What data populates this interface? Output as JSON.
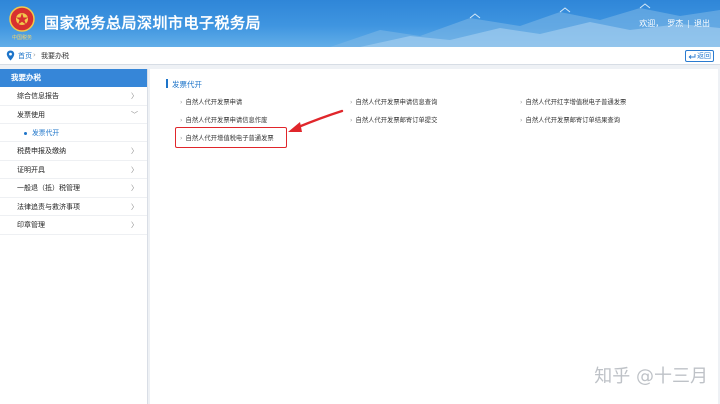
{
  "header": {
    "title": "国家税务总局深圳市电子税务局",
    "welcome": "欢迎，",
    "user": "罗杰",
    "logout": "退出",
    "emblem_text": "中国税务"
  },
  "breadcrumb": {
    "home": "首页",
    "separator": "›",
    "current": "我要办税",
    "back_label": "返回"
  },
  "sidebar": {
    "heading": "我要办税",
    "items": [
      {
        "label": "综合信息报告",
        "chev": "〉"
      },
      {
        "label": "发票使用",
        "chev": "﹀"
      },
      {
        "label": "税费申报及缴纳",
        "chev": "〉"
      },
      {
        "label": "证明开具",
        "chev": "〉"
      },
      {
        "label": "一般退（抵）税管理",
        "chev": "〉"
      },
      {
        "label": "法律追责与救济事项",
        "chev": "〉"
      },
      {
        "label": "印章管理",
        "chev": "〉"
      }
    ],
    "sub_item": "发票代开"
  },
  "main": {
    "section_title": "发票代开",
    "bullet": "›",
    "links": [
      "自然人代开发票申请",
      "自然人代开发票申请信息查询",
      "自然人代开红字增值税电子普通发票",
      "自然人代开发票申请信息作废",
      "自然人代开发票邮寄订单提交",
      "自然人代开发票邮寄订单结果查询",
      "自然人代开增值税电子普通发票"
    ]
  },
  "watermark": "知乎 @十三月",
  "colors": {
    "header_blue": "#3f95e0",
    "accent_blue": "#1d74c9",
    "highlight_red": "#e0262b"
  }
}
